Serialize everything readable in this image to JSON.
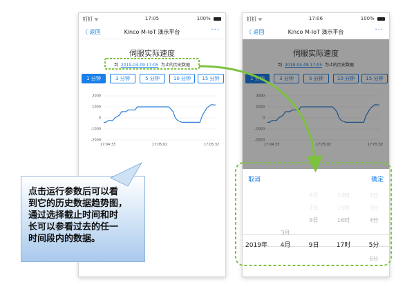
{
  "colors": {
    "accent": "#1a7fe8",
    "highlight": "#7cc23f",
    "series": "#2f80d9"
  },
  "phones": [
    {
      "status": {
        "carrier": "钉钉 ᯤ",
        "time": "17:05",
        "battery": "100%"
      },
      "nav": {
        "back": "〈 返回",
        "title": "Kinco M-IoT 演示平台",
        "more": "···"
      },
      "title": "伺服实际速度",
      "date": {
        "prefix": "到",
        "value": "2019-04-09 17:05",
        "suffix": "为止的历史数据"
      },
      "intervals": [
        "1 分钟",
        "3 分钟",
        "5 分钟",
        "10 分钟",
        "15 分钟"
      ],
      "active_interval": "1 分钟",
      "chart_data": {
        "type": "line",
        "y_ticks": [
          "2000",
          "1000",
          "0",
          "-1000",
          "-2000"
        ],
        "x_ticks": [
          "17:04:33",
          "17:05:02",
          "17:05:32"
        ],
        "ylim": [
          -2000,
          2000
        ],
        "grid": true
      }
    },
    {
      "status": {
        "carrier": "钉钉 ᯤ",
        "time": "17:06",
        "battery": "100%"
      },
      "nav": {
        "back": "〈 返回",
        "title": "Kinco M-IoT 演示平台",
        "more": "···"
      },
      "title": "伺服实际速度",
      "date": {
        "prefix": "到",
        "value": "2019-04-09 17:05",
        "suffix": "为止的历史数据"
      },
      "intervals": [
        "1 分钟",
        "3 分钟",
        "5 分钟",
        "10 分钟",
        "15 分钟"
      ],
      "active_interval": "1 分钟",
      "chart_data": {
        "type": "line",
        "y_ticks": [
          "2000",
          "1000",
          "0",
          "-1000",
          "-2000"
        ],
        "x_ticks": [
          "17:04:33",
          "17:05:02",
          "17:05:32"
        ],
        "ylim": [
          -2000,
          2000
        ],
        "grid": true
      }
    }
  ],
  "picker": {
    "cancel": "取消",
    "confirm": "确定",
    "columns": [
      {
        "name": "year",
        "items": [
          "",
          "",
          "",
          "",
          "2019年",
          ""
        ]
      },
      {
        "name": "month",
        "items": [
          "",
          "",
          "",
          "3月",
          "4月",
          ""
        ]
      },
      {
        "name": "day",
        "items": [
          "6日",
          "7日",
          "8日",
          "",
          "9日",
          ""
        ]
      },
      {
        "name": "hour",
        "items": [
          "14时",
          "15时",
          "16时",
          "",
          "17时",
          ""
        ]
      },
      {
        "name": "minute",
        "items": [
          "2分",
          "3分",
          "4分",
          "",
          "5分",
          "6分"
        ]
      }
    ]
  },
  "callout": {
    "text": "点击运行参数后可以看\n到它的历史数据趋势图，\n通过选择截止时间和时\n长可以参看过去的任一\n时间段内的数据。"
  }
}
